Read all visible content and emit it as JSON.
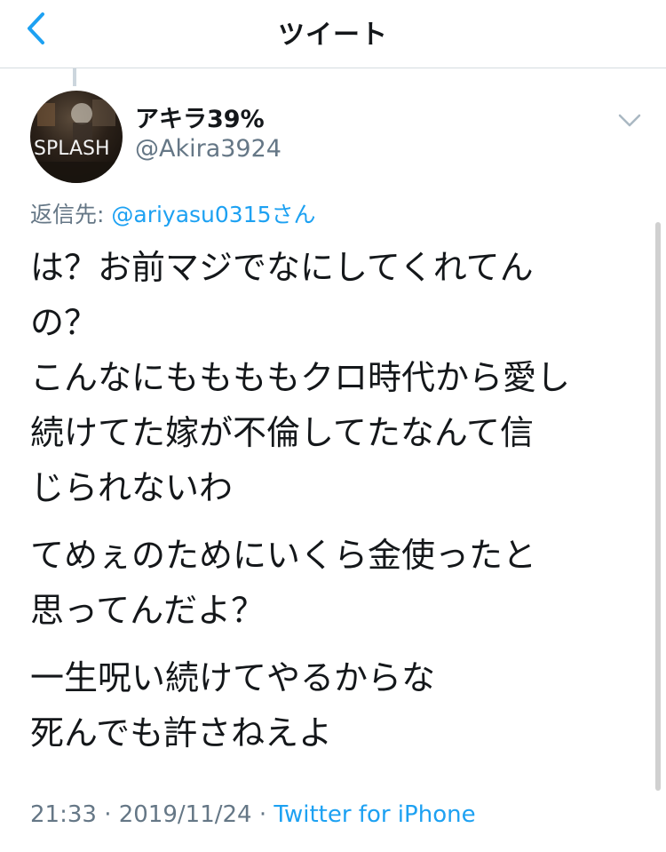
{
  "nav": {
    "title": "ツイート",
    "back_icon": "chevron-left-icon"
  },
  "tweet": {
    "avatar_text": "SPLASH",
    "display_name": "アキラ39%",
    "handle": "@Akira3924",
    "reply_prefix": "返信先: ",
    "reply_mention": "@ariyasu0315さん",
    "body": [
      [
        "は？お前マジでなにしてくれてん",
        "の？",
        "こんなにももももクロ時代から愛し",
        "続けてた嫁が不倫してたなんて信",
        "じられないわ"
      ],
      [
        "てめぇのためにいくら金使ったと",
        "思ってんだよ？"
      ],
      [
        "一生呪い続けてやるからな",
        "死んでも許さねえよ"
      ]
    ],
    "time": "21:33",
    "date": "2019/11/24",
    "separator": " · ",
    "source": "Twitter for iPhone"
  },
  "colors": {
    "accent": "#1da1f2",
    "secondary_text": "#657786",
    "divider": "#d5dbe0"
  }
}
